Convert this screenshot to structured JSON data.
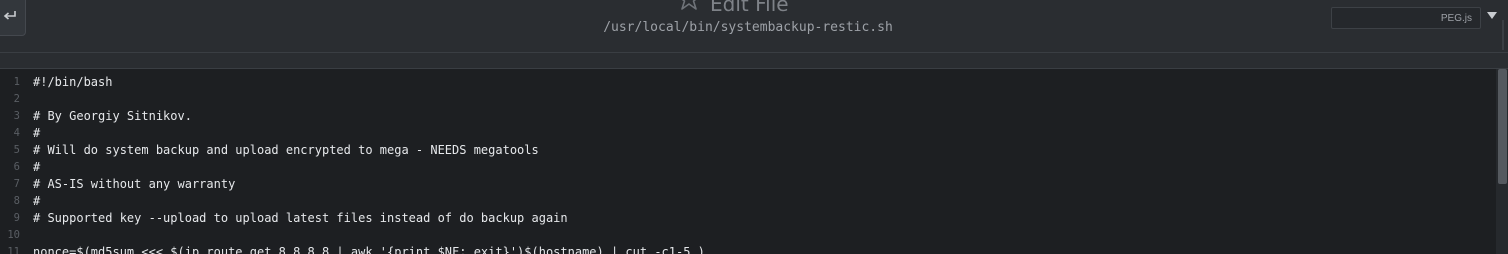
{
  "header": {
    "title": "Edit File",
    "path": "/usr/local/bin/systembackup-restic.sh",
    "mode_value": "PEG.js",
    "icons": {
      "back": "back-arrow-icon",
      "favorite": "star-icon",
      "mode_dropdown": "caret-down-icon"
    }
  },
  "editor": {
    "lines": [
      {
        "n": "1",
        "text": "#!/bin/bash"
      },
      {
        "n": "2",
        "text": ""
      },
      {
        "n": "3",
        "text": "# By Georgiy Sitnikov."
      },
      {
        "n": "4",
        "text": "#"
      },
      {
        "n": "5",
        "text": "# Will do system backup and upload encrypted to mega - NEEDS megatools"
      },
      {
        "n": "6",
        "text": "#"
      },
      {
        "n": "7",
        "text": "# AS-IS without any warranty"
      },
      {
        "n": "8",
        "text": "#"
      },
      {
        "n": "9",
        "text": "# Supported key --upload to upload latest files instead of do backup again"
      },
      {
        "n": "10",
        "text": ""
      },
      {
        "n": "11",
        "text": "nonce=$(md5sum <<< $(ip route get 8.8.8.8 | awk '{print $NF; exit}')$(hostname) | cut -c1-5 )"
      }
    ]
  }
}
